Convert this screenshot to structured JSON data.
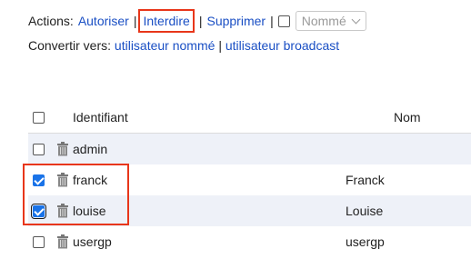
{
  "actions": {
    "label": "Actions:",
    "autoriser": "Autoriser",
    "interdire": "Interdire",
    "supprimer": "Supprimer",
    "separator": "|",
    "select_value": "Nommé"
  },
  "convert": {
    "label": "Convertir vers:",
    "nomme": "utilisateur nommé",
    "separator": "|",
    "broadcast": "utilisateur broadcast"
  },
  "table": {
    "headers": {
      "id": "Identifiant",
      "nom": "Nom"
    },
    "rows": [
      {
        "id": "admin",
        "nom": "",
        "checked": false
      },
      {
        "id": "franck",
        "nom": "Franck",
        "checked": true
      },
      {
        "id": "louise",
        "nom": "Louise",
        "checked": true
      },
      {
        "id": "usergp",
        "nom": "usergp",
        "checked": false
      }
    ]
  },
  "colors": {
    "link": "#1a4fc4",
    "highlight": "#e8361a",
    "checkbox_checked": "#1a73e8",
    "row_alt": "#eef1f8"
  }
}
